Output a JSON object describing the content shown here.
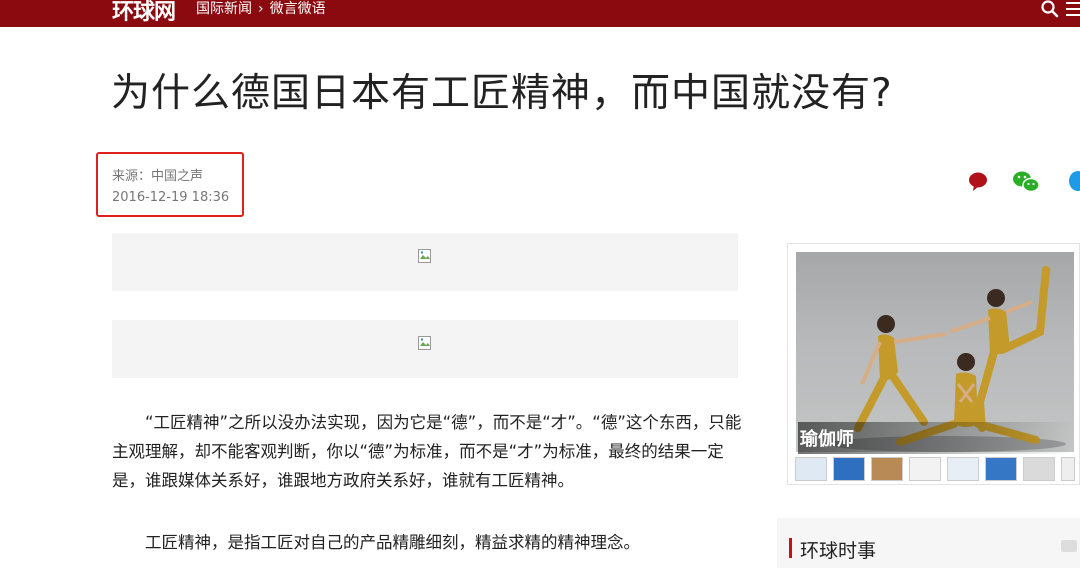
{
  "header": {
    "logo": "环球网",
    "breadcrumbs": [
      "国际新闻",
      "微言微语"
    ],
    "separator": "›"
  },
  "article": {
    "title": "为什么德国日本有工匠精神，而中国就没有?",
    "source": "来源：中国之声",
    "date": "2016-12-19 18:36",
    "paragraphs": [
      "“工匠精神”之所以没办法实现，因为它是“德”，而不是“才”。“德”这个东西，只能主观理解，却不能客观判断，你以“德”为标准，而不是“才”为标准，最终的结果一定是，谁跟媒体关系好，谁跟地方政府关系好，谁就有工匠精神。",
      "工匠精神，是指工匠对自己的产品精雕细刻，精益求精的精神理念。"
    ]
  },
  "share": {
    "icons": [
      "comment-icon",
      "wechat-icon",
      "qq-icon"
    ],
    "colors": {
      "comment": "#b01018",
      "wechat": "#2aae25",
      "qq": "#1e9be8"
    }
  },
  "sidebar": {
    "feature_caption": "瑜伽师",
    "section_title": "环球时事"
  },
  "colors": {
    "brand": "#8b0a0f",
    "highlight_box": "#e02020"
  }
}
